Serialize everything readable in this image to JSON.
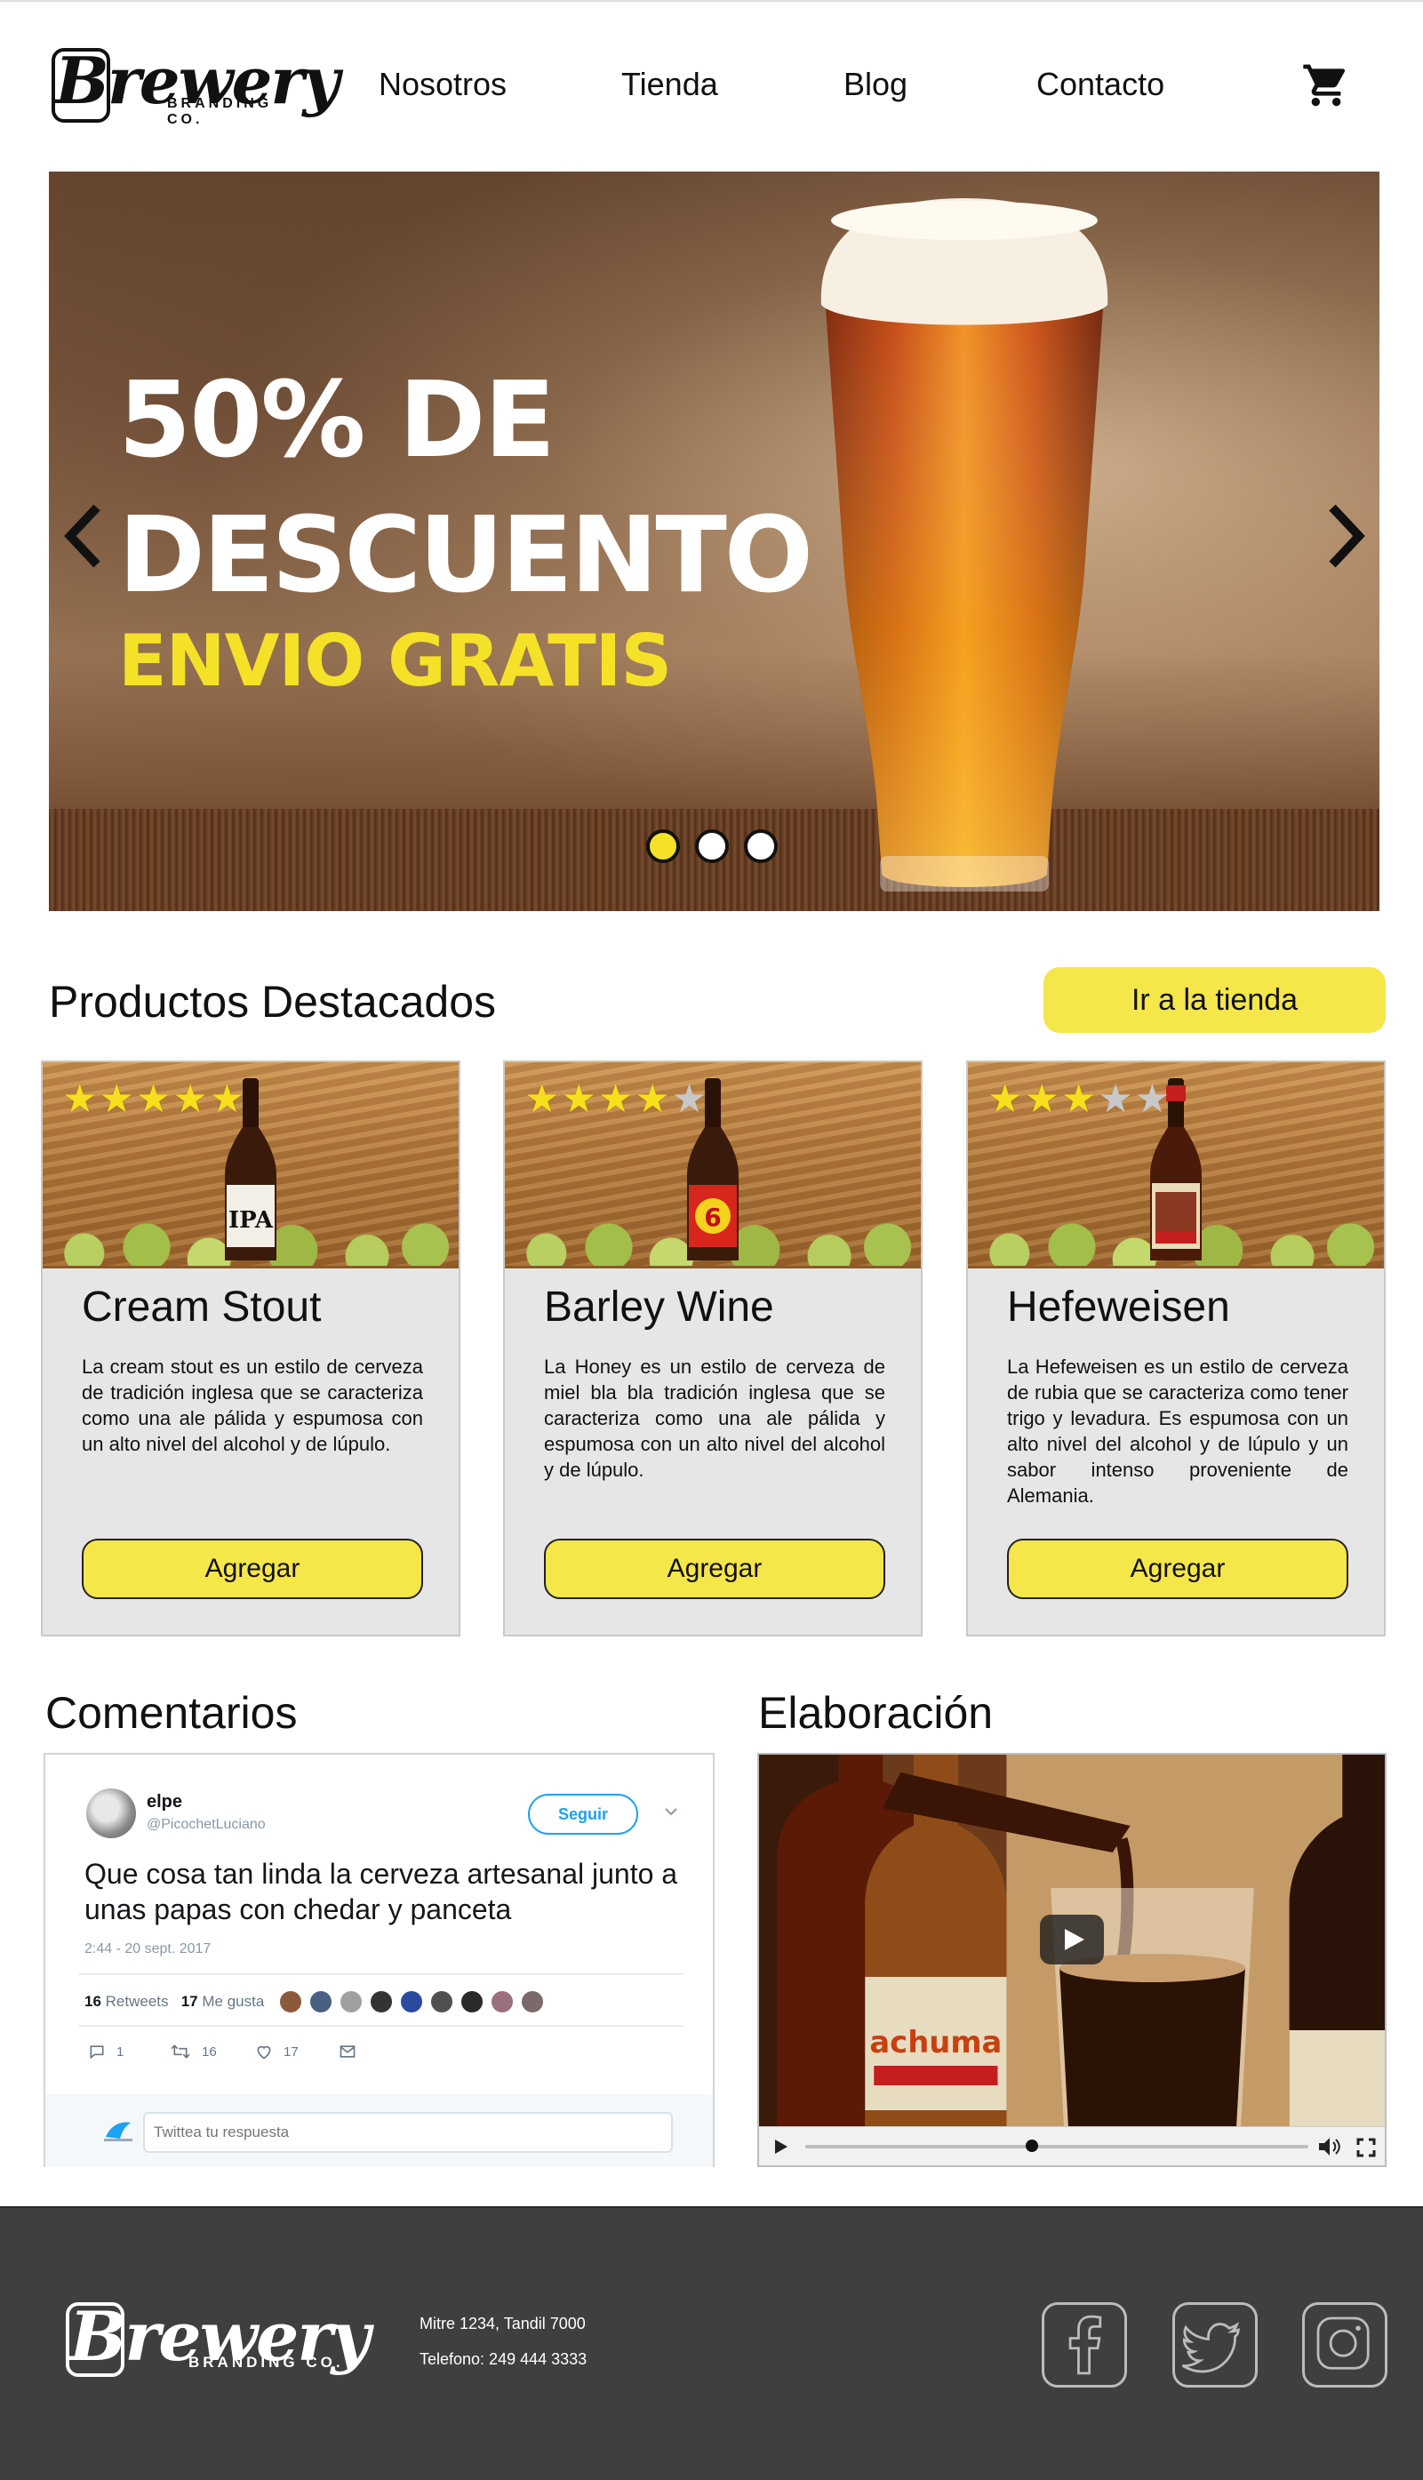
{
  "header": {
    "logo_text": "Brewery",
    "logo_sub": "BRANDING CO.",
    "nav": [
      {
        "label": "Nosotros"
      },
      {
        "label": "Tienda"
      },
      {
        "label": "Blog"
      },
      {
        "label": "Contacto"
      }
    ],
    "cart_icon": "shopping-cart-icon"
  },
  "hero": {
    "line1": "50% DE",
    "line2": "DESCUENTO",
    "line3": "ENVIO GRATIS",
    "slides": 3,
    "active_slide": 1,
    "accent_color": "#f5e228"
  },
  "featured": {
    "title": "Productos Destacados",
    "shop_button": "Ir a la tienda",
    "products": [
      {
        "name": "Cream Stout",
        "rating": 5,
        "description": "La cream stout es un estilo de cerveza de tradición inglesa que se caracteriza como una ale pálida y espumosa con un alto nivel del alcohol y de lúpulo.",
        "button": "Agregar",
        "bottle_label": "IPA"
      },
      {
        "name": "Barley Wine",
        "rating": 4,
        "description": "La Honey es un estilo de cerveza de miel bla bla tradición inglesa que se caracteriza como una ale pálida y espumosa con un alto nivel del alcohol y de lúpulo.",
        "button": "Agregar",
        "bottle_label": "6"
      },
      {
        "name": "Hefeweisen",
        "rating": 3,
        "description": "La Hefeweisen es un estilo de cerveza de rubia que se caracteriza como tener trigo y levadura. Es espumosa con un alto nivel del alcohol y de lúpulo y un sabor intenso proveniente de Alemania.",
        "button": "Agregar",
        "bottle_label": ""
      }
    ]
  },
  "comments": {
    "title": "Comentarios",
    "tweet": {
      "name": "elpe",
      "handle": "@PicochetLuciano",
      "follow": "Seguir",
      "text": "Que cosa tan linda la cerveza artesanal junto a unas papas con chedar y panceta",
      "date": "2:44 - 20 sept. 2017",
      "retweets": "16",
      "retweets_label": "Retweets",
      "likes": "17",
      "likes_label": "Me gusta",
      "reply_count": "1",
      "retweet_count": "16",
      "like_count": "17",
      "reply_placeholder": "Twittea tu respuesta"
    }
  },
  "video": {
    "title": "Elaboración",
    "bottle_brand": "achuma",
    "progress": 0.45
  },
  "footer": {
    "logo_text": "Brewery",
    "logo_sub": "BRANDING CO.",
    "address": "Mitre 1234, Tandil 7000",
    "phone": "Telefono: 249 444 3333",
    "social": [
      "facebook-icon",
      "twitter-icon",
      "instagram-icon"
    ]
  }
}
